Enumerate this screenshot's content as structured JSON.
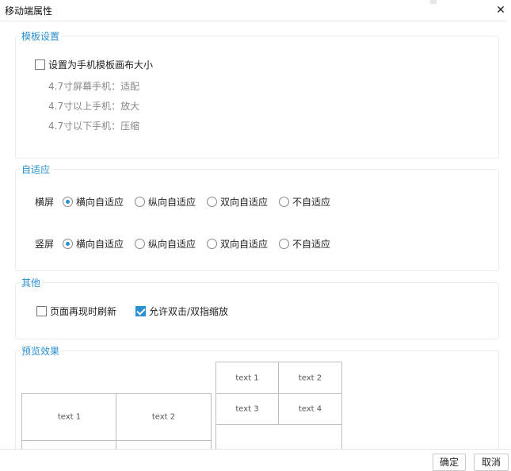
{
  "window": {
    "title": "移动端属性",
    "close_glyph": "✕"
  },
  "template_section": {
    "legend": "模板设置",
    "checkbox_label": "设置为手机模板画布大小",
    "checkbox_checked": false,
    "hints": [
      "4.7寸屏幕手机：适配",
      "4.7寸以上手机：放大",
      "4.7寸以下手机：压缩"
    ]
  },
  "adaptive_section": {
    "legend": "自适应",
    "landscape_label": "横屏",
    "portrait_label": "竖屏",
    "options": [
      "横向自适应",
      "纵向自适应",
      "双向自适应",
      "不自适应"
    ],
    "landscape_selected": "横向自适应",
    "portrait_selected": "横向自适应"
  },
  "other_section": {
    "legend": "其他",
    "refresh_label": "页面再现时刷新",
    "refresh_checked": false,
    "zoom_label": "允许双击/双指缩放",
    "zoom_checked": true
  },
  "preview_section": {
    "legend": "预览效果",
    "large_table": [
      "text 1",
      "text 2"
    ],
    "small_table": [
      "text 1",
      "text 2",
      "text 3",
      "text 4"
    ]
  },
  "footer": {
    "ok_label": "确定",
    "cancel_label": "取消"
  },
  "colors": {
    "accent": "#2a8fd0",
    "hint": "#888888",
    "border": "#ececec"
  }
}
